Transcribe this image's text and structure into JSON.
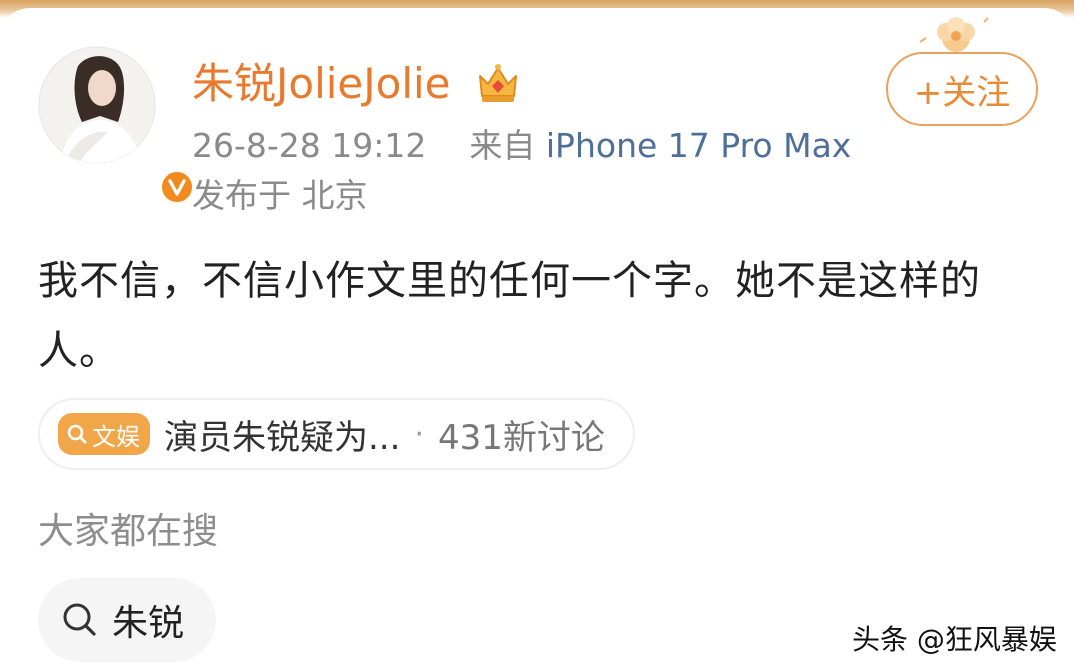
{
  "post": {
    "username": "朱锐JolieJolie",
    "timestamp": "26-8-28 19:12",
    "source_prefix": "来自",
    "device": "iPhone 17 Pro Max",
    "location": "发布于 北京",
    "text": "我不信，不信小作文里的任何一个字。她不是这样的人。"
  },
  "follow_button": {
    "label": "+关注"
  },
  "topic": {
    "badge": "文娱",
    "title": "演员朱锐疑为...",
    "separator": "·",
    "count": "431新讨论"
  },
  "search": {
    "heading": "大家都在搜",
    "chip_label": "朱锐"
  },
  "watermark": "头条 @狂风暴娱",
  "colors": {
    "username": "#e9792d",
    "device_link": "#4d6f9a",
    "follow_border": "#e9a15c",
    "topic_badge": "#f2a64a",
    "verified_badge": "#f38a1d"
  },
  "icons": {
    "verified": "verified-v-icon",
    "crown": "crown-icon",
    "search": "search-icon",
    "decoration": "flower-icon"
  }
}
